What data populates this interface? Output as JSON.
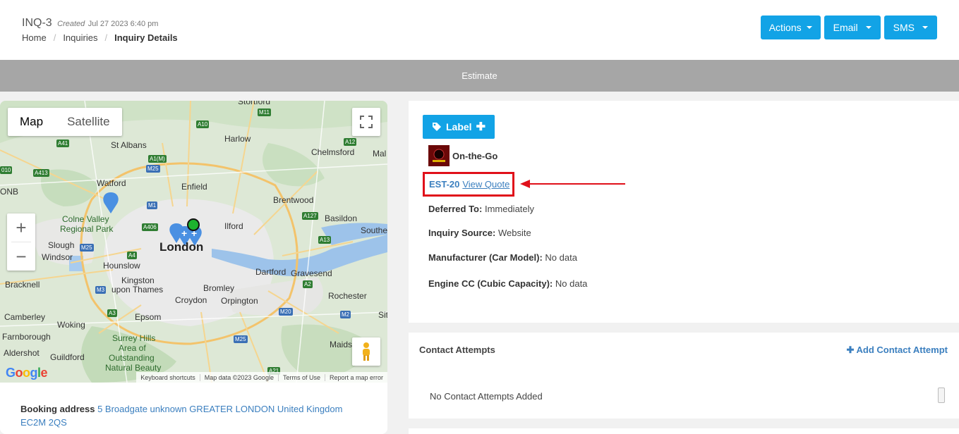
{
  "header": {
    "inquiry_id": "INQ-3",
    "created_label": "Created",
    "created_date": "Jul 27 2023 6:40 pm",
    "breadcrumb": [
      "Home",
      "Inquiries",
      "Inquiry Details"
    ],
    "buttons": {
      "actions": "Actions",
      "email": "Email",
      "sms": "SMS"
    }
  },
  "estimate_bar": {
    "label": "Estimate"
  },
  "map": {
    "type_toggle": {
      "map": "Map",
      "satellite": "Satellite"
    },
    "places": {
      "stortford": "Stortford",
      "harlow": "Harlow",
      "st_albans": "St Albans",
      "chelmsford": "Chelmsford",
      "mal": "Mal",
      "watford": "Watford",
      "enfield": "Enfield",
      "brentwood": "Brentwood",
      "colne_valley": "Colne Valley",
      "regional_park": "Regional Park",
      "ilford": "Ilford",
      "basildon": "Basildon",
      "southend": "Southe",
      "slough": "Slough",
      "london": "London",
      "windsor": "Windsor",
      "hounslow": "Hounslow",
      "dartford": "Dartford",
      "gravesend": "Gravesend",
      "bracknell": "Bracknell",
      "kingston": "Kingston",
      "upon_thames": "upon Thames",
      "bromley": "Bromley",
      "croydon": "Croydon",
      "orpington": "Orpington",
      "rochester": "Rochester",
      "camberley": "Camberley",
      "woking": "Woking",
      "epsom": "Epsom",
      "farnborough": "Farnborough",
      "surrey_hills": "Surrey Hills",
      "area_of": "Area of",
      "outstanding": "Outstanding",
      "natural_beauty": "Natural Beauty",
      "aldershot": "Aldershot",
      "guildford": "Guildford",
      "maids": "Maids",
      "sit": "Sit",
      "onb": "ONB"
    },
    "roads": {
      "m11": "M11",
      "a10": "A10",
      "a41": "A41",
      "a12": "A12",
      "a1m": "A1(M)",
      "m25": "M25",
      "a413": "A413",
      "a10b": "010",
      "m1": "M1",
      "a127": "A127",
      "a406": "A406",
      "a13": "A13",
      "m25b": "M25",
      "a4": "A4",
      "a2": "A2",
      "m3": "M3",
      "m20": "M20",
      "a3": "A3",
      "m2": "M2",
      "m25c": "M25",
      "a21": "A21"
    },
    "attribution": [
      "Keyboard shortcuts",
      "Map data ©2023 Google",
      "Terms of Use",
      "Report a map error"
    ],
    "google_logo": "Google"
  },
  "booking": {
    "label": "Booking address",
    "address": "5 Broadgate unknown GREATER LONDON United Kingdom EC2M 2QS"
  },
  "details": {
    "label_button": "Label",
    "company": "On-the-Go",
    "estimate_id": "EST-20",
    "view_quote": "View Quote",
    "deferred_label": "Deferred To:",
    "deferred_value": "Immediately",
    "source_label": "Inquiry Source:",
    "source_value": "Website",
    "manufacturer_label": "Manufacturer (Car Model):",
    "manufacturer_value": "No data",
    "engine_label": "Engine CC (Cubic Capacity):",
    "engine_value": "No data"
  },
  "contact": {
    "title": "Contact Attempts",
    "add_button": "Add Contact Attempt",
    "empty": "No Contact Attempts Added"
  },
  "colors": {
    "accent": "#12a3e6",
    "link": "#3b7fbf",
    "highlight": "#e0101a",
    "bar": "#a6a6a6"
  }
}
